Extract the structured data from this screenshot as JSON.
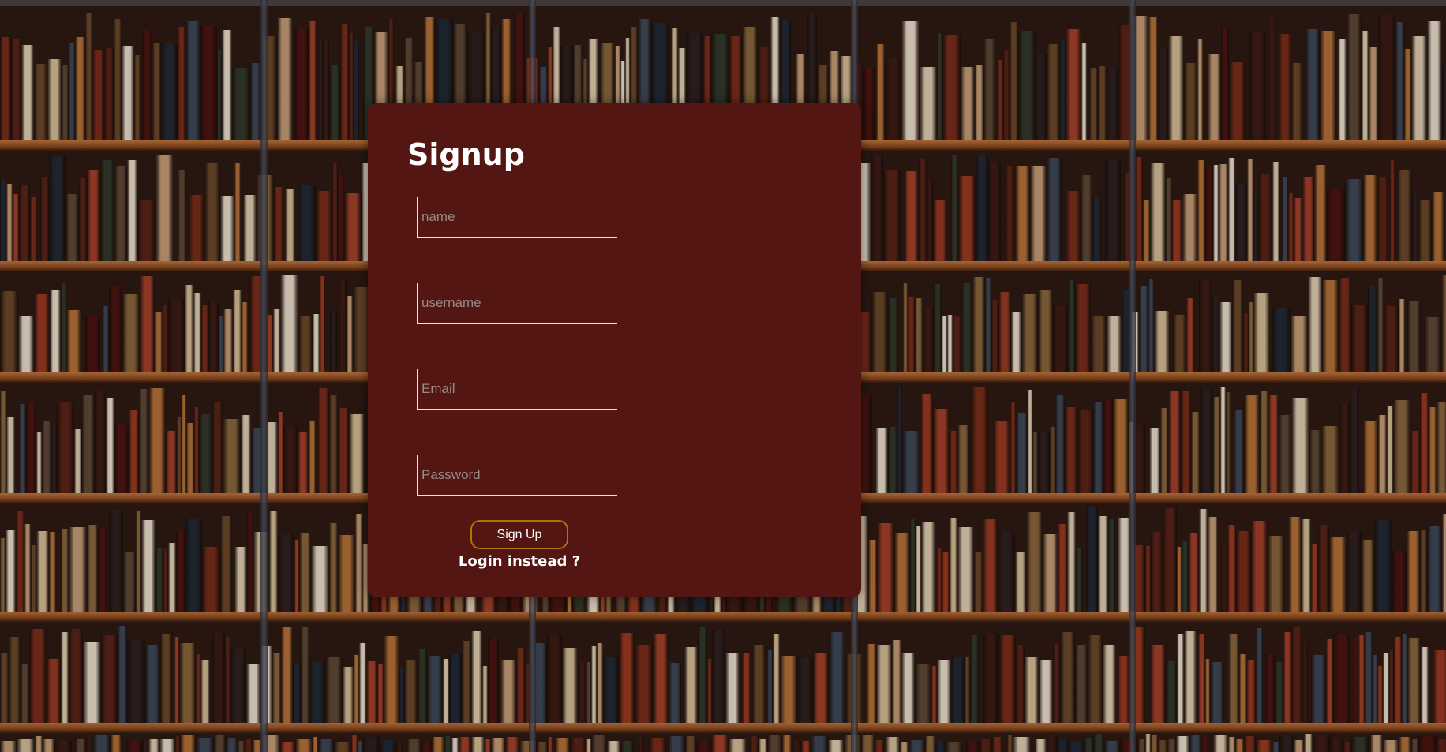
{
  "signup": {
    "title": "Signup",
    "fields": {
      "name_placeholder": "name",
      "username_placeholder": "username",
      "email_placeholder": "Email",
      "password_placeholder": "Password"
    },
    "submit_label": "Sign Up",
    "login_link": "Login instead ?"
  },
  "colors": {
    "panel_background": "#531612",
    "button_border": "#a7760c",
    "text": "#ffffff"
  }
}
